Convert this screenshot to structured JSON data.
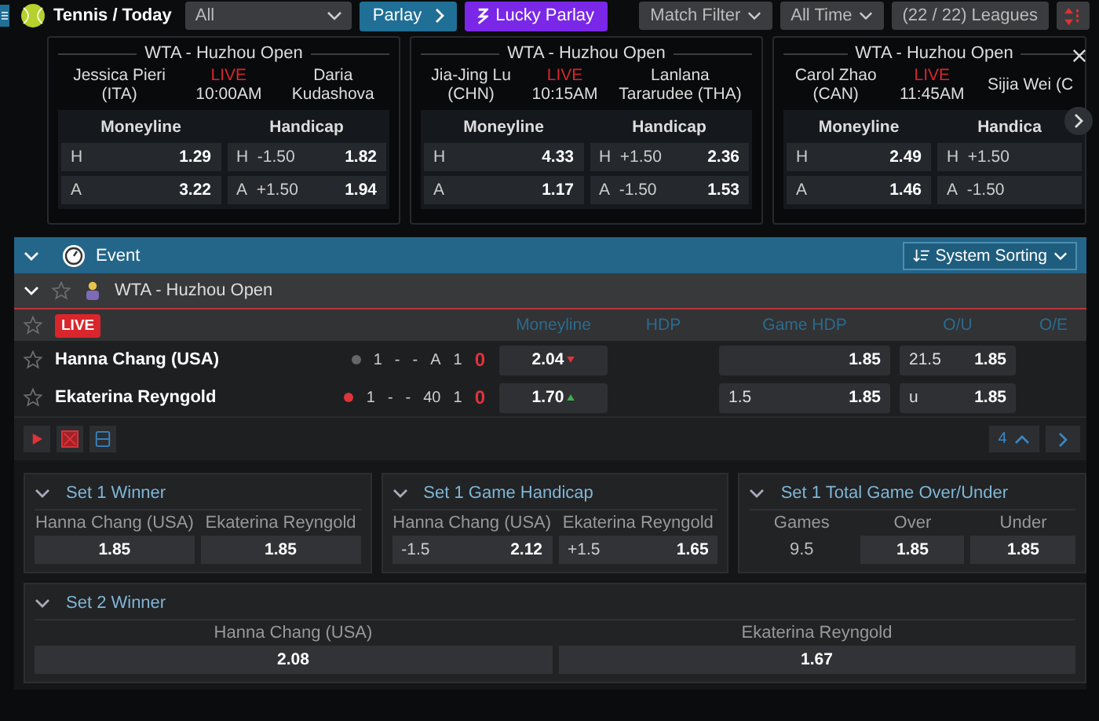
{
  "topbar": {
    "title": "Tennis / Today",
    "filter": {
      "value": "All"
    },
    "buttons": [
      {
        "label": "Parlay",
        "kind": "parlay"
      },
      {
        "label": "Lucky Parlay",
        "kind": "lucky"
      }
    ],
    "right_buttons": [
      {
        "label": "Match Filter",
        "dropdown": true
      },
      {
        "label": "All Time",
        "dropdown": true
      },
      {
        "label": "(22 / 22) Leagues",
        "dropdown": false
      }
    ]
  },
  "cards": [
    {
      "title": "WTA - Huzhou Open",
      "home": "Jessica Pieri\n(ITA)",
      "status": "LIVE",
      "time": "10:00AM",
      "away": "Daria\nKudashova",
      "moneyline_label": "Moneyline",
      "handicap_label": "Handicap",
      "moneyline": [
        {
          "side": "H",
          "odds": "1.29"
        },
        {
          "side": "A",
          "odds": "3.22"
        }
      ],
      "handicap": [
        {
          "side": "H",
          "line": "-1.50",
          "odds": "1.82"
        },
        {
          "side": "A",
          "line": "+1.50",
          "odds": "1.94"
        }
      ]
    },
    {
      "title": "WTA - Huzhou Open",
      "home": "Jia-Jing Lu\n(CHN)",
      "status": "LIVE",
      "time": "10:15AM",
      "away": "Lanlana\nTararudee (THA)",
      "moneyline_label": "Moneyline",
      "handicap_label": "Handicap",
      "moneyline": [
        {
          "side": "H",
          "odds": "4.33"
        },
        {
          "side": "A",
          "odds": "1.17"
        }
      ],
      "handicap": [
        {
          "side": "H",
          "line": "+1.50",
          "odds": "2.36"
        },
        {
          "side": "A",
          "line": "-1.50",
          "odds": "1.53"
        }
      ]
    },
    {
      "title": "WTA - Huzhou Open",
      "home": "Carol Zhao\n(CAN)",
      "status": "LIVE",
      "time": "11:45AM",
      "away": "Sijia Wei (C",
      "moneyline_label": "Moneyline",
      "handicap_label": "Handica",
      "moneyline": [
        {
          "side": "H",
          "odds": "2.49"
        },
        {
          "side": "A",
          "odds": "1.46"
        }
      ],
      "handicap": [
        {
          "side": "H",
          "line": "+1.50"
        },
        {
          "side": "A",
          "line": "-1.50"
        }
      ]
    }
  ],
  "event_bar": {
    "label": "Event",
    "expanded": true,
    "sort": "System Sorting"
  },
  "league": {
    "name": "WTA - Huzhou Open",
    "expanded": true,
    "favorite": false
  },
  "table": {
    "badge": "LIVE",
    "columns": [
      "Moneyline",
      "HDP",
      "Game HDP",
      "O/U",
      "O/E"
    ],
    "rows": [
      {
        "name": "Hanna Chang (USA)",
        "favorite": false,
        "serving": false,
        "scores": [
          "1",
          "-",
          "-",
          "A",
          "1"
        ],
        "sets": "0",
        "moneyline": {
          "odds": "2.04",
          "rising": false
        },
        "game_hdp": {
          "odds": "1.85"
        },
        "ou": {
          "line": "21.5",
          "odds": "1.85"
        }
      },
      {
        "name": "Ekaterina Reyngold",
        "favorite": false,
        "serving": true,
        "scores": [
          "1",
          "-",
          "-",
          "40",
          "1"
        ],
        "sets": "0",
        "moneyline": {
          "odds": "1.70",
          "rising": true
        },
        "game_hdp": {
          "line": "1.5",
          "odds": "1.85"
        },
        "ou": {
          "line": "u",
          "odds": "1.85"
        }
      }
    ],
    "more_count": "4"
  },
  "market_rows": [
    [
      {
        "title": "Set 1 Winner",
        "expanded": true,
        "options": [
          {
            "kind": "odds",
            "label": "Hanna Chang (USA)",
            "odds": "1.85"
          },
          {
            "kind": "odds",
            "label": "Ekaterina Reyngold",
            "odds": "1.85"
          }
        ]
      },
      {
        "title": "Set 1 Game Handicap",
        "expanded": true,
        "options": [
          {
            "kind": "odds",
            "label": "Hanna Chang (USA)",
            "line": "-1.5",
            "odds": "2.12"
          },
          {
            "kind": "odds",
            "label": "Ekaterina Reyngold",
            "line": "+1.5",
            "odds": "1.65"
          }
        ]
      },
      {
        "title": "Set 1 Total Game Over/Under",
        "expanded": true,
        "options": [
          {
            "kind": "value",
            "label": "Games",
            "value": "9.5"
          },
          {
            "kind": "odds",
            "label": "Over",
            "odds": "1.85"
          },
          {
            "kind": "odds",
            "label": "Under",
            "odds": "1.85"
          }
        ]
      }
    ],
    [
      {
        "title": "Set 2 Winner",
        "expanded": true,
        "options": [
          {
            "kind": "odds",
            "label": "Hanna Chang (USA)",
            "odds": "2.08"
          },
          {
            "kind": "odds",
            "label": "Ekaterina Reyngold",
            "odds": "1.67"
          }
        ]
      }
    ]
  ]
}
